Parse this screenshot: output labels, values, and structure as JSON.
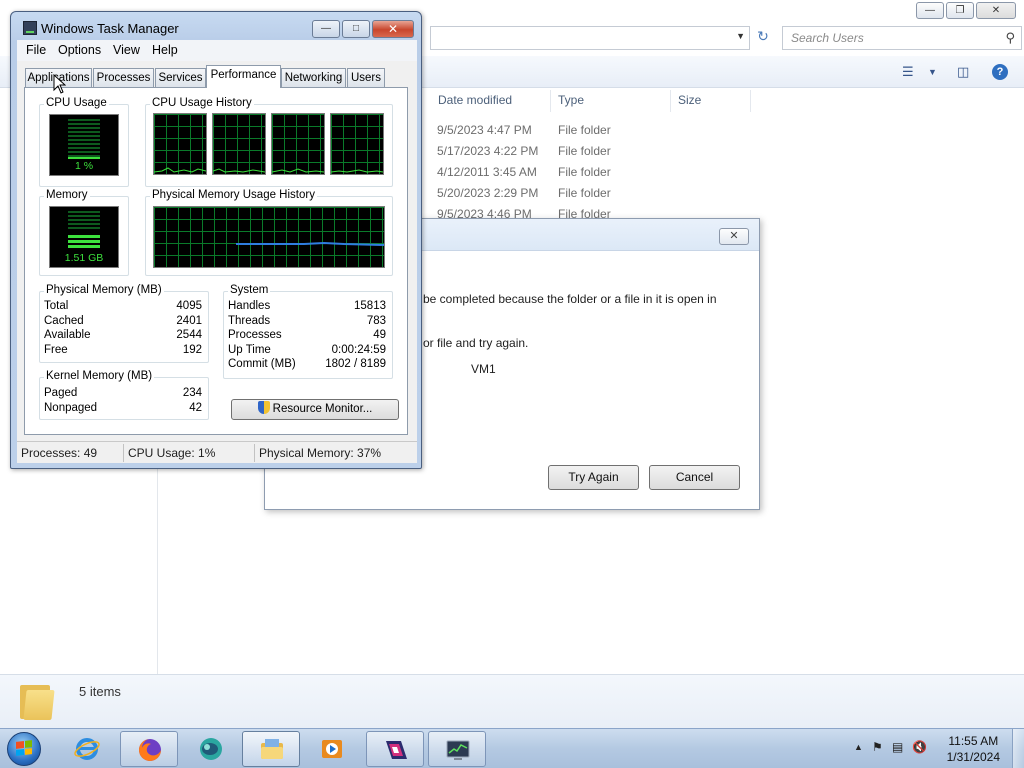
{
  "explorer": {
    "search_placeholder": "Search Users",
    "columns": {
      "date_modified": "Date modified",
      "type": "Type",
      "size": "Size"
    },
    "rows": [
      {
        "date": "9/5/2023 4:47 PM",
        "type": "File folder"
      },
      {
        "date": "5/17/2023 4:22 PM",
        "type": "File folder"
      },
      {
        "date": "4/12/2011 3:45 AM",
        "type": "File folder"
      },
      {
        "date": "5/20/2023 2:29 PM",
        "type": "File folder"
      },
      {
        "date": "9/5/2023 4:46 PM",
        "type": "File folder"
      }
    ],
    "items_count": "5 items"
  },
  "dialog": {
    "message1": "be completed because the folder or a file in it is open in",
    "message2": "or file and try again.",
    "item_name": "VM1",
    "try_again_label": "Try Again",
    "cancel_label": "Cancel"
  },
  "taskmgr": {
    "title": "Windows Task Manager",
    "menu": [
      "File",
      "Options",
      "View",
      "Help"
    ],
    "tabs": [
      "Applications",
      "Processes",
      "Services",
      "Performance",
      "Networking",
      "Users"
    ],
    "active_tab": "Performance",
    "cpu_usage_label": "CPU Usage",
    "cpu_usage_value": "1 %",
    "cpu_history_label": "CPU Usage History",
    "memory_label": "Memory",
    "memory_value": "1.51 GB",
    "memory_history_label": "Physical Memory Usage History",
    "physical_memory": {
      "label": "Physical Memory (MB)",
      "rows": [
        {
          "k": "Total",
          "v": "4095"
        },
        {
          "k": "Cached",
          "v": "2401"
        },
        {
          "k": "Available",
          "v": "2544"
        },
        {
          "k": "Free",
          "v": "192"
        }
      ]
    },
    "kernel_memory": {
      "label": "Kernel Memory (MB)",
      "rows": [
        {
          "k": "Paged",
          "v": "234"
        },
        {
          "k": "Nonpaged",
          "v": "42"
        }
      ]
    },
    "system": {
      "label": "System",
      "rows": [
        {
          "k": "Handles",
          "v": "15813"
        },
        {
          "k": "Threads",
          "v": "783"
        },
        {
          "k": "Processes",
          "v": "49"
        },
        {
          "k": "Up Time",
          "v": "0:00:24:59"
        },
        {
          "k": "Commit (MB)",
          "v": "1802 / 8189"
        }
      ]
    },
    "resource_monitor_label": "Resource Monitor...",
    "status": {
      "processes": "Processes: 49",
      "cpu": "CPU Usage: 1%",
      "memory": "Physical Memory: 37%"
    }
  },
  "taskbar": {
    "clock_time": "11:55 AM",
    "clock_date": "1/31/2024"
  },
  "colors": {
    "graph_green": "#3de13d",
    "grid_green": "#0a7a2a",
    "memory_line": "#2f7de0",
    "taskbar_top": "#cdddef",
    "close_red": "#c8462d"
  }
}
